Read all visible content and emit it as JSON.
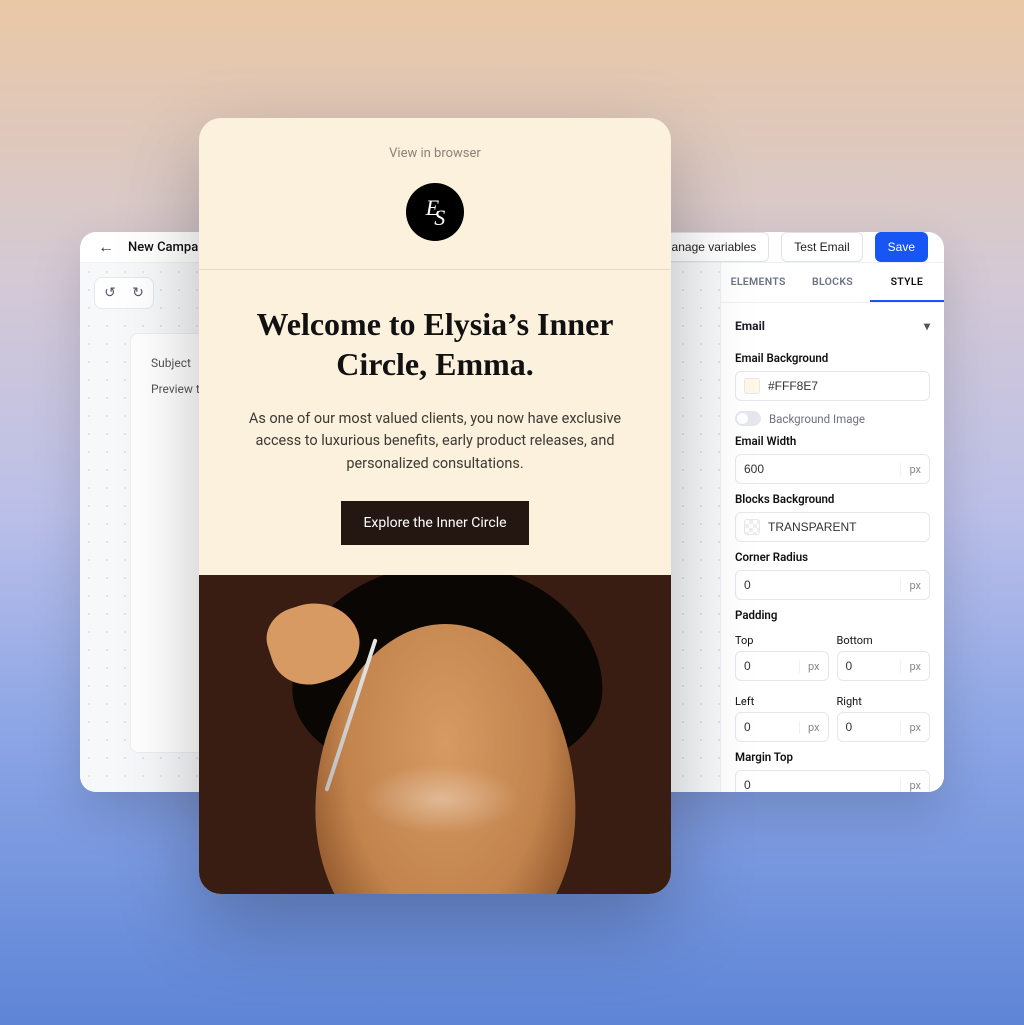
{
  "editor": {
    "title": "New Campaign",
    "buttons": {
      "manage_variables": "Manage variables",
      "test_email": "Test Email",
      "save": "Save"
    },
    "canvas_fields": {
      "subject": "Subject",
      "preview_text": "Preview text"
    }
  },
  "panel": {
    "tabs": {
      "elements": "ELEMENTS",
      "blocks": "BLOCKS",
      "style": "STYLE"
    },
    "section_title": "Email",
    "labels": {
      "email_background": "Email Background",
      "background_image": "Background Image",
      "email_width": "Email Width",
      "blocks_background": "Blocks Background",
      "corner_radius": "Corner Radius",
      "padding": "Padding",
      "top": "Top",
      "bottom": "Bottom",
      "left": "Left",
      "right": "Right",
      "margin_top": "Margin Top",
      "unit_px": "px"
    },
    "values": {
      "email_background": "#FFF8E7",
      "email_width": "600",
      "blocks_background": "TRANSPARENT",
      "corner_radius": "0",
      "padding_top": "0",
      "padding_bottom": "0",
      "padding_left": "0",
      "padding_right": "0",
      "margin_top": "0"
    }
  },
  "email_preview": {
    "view_in_browser": "View in browser",
    "logo_text_e": "E",
    "logo_text_s": "S",
    "heading": "Welcome to Elysia’s Inner Circle, Emma.",
    "body": "As one of our most valued clients, you now have exclusive access to luxurious benefits, early product releases, and personalized consultations.",
    "cta": "Explore the Inner Circle"
  },
  "colors": {
    "panel_swatch": "#FFF8E7",
    "primary": "#1755f4"
  }
}
